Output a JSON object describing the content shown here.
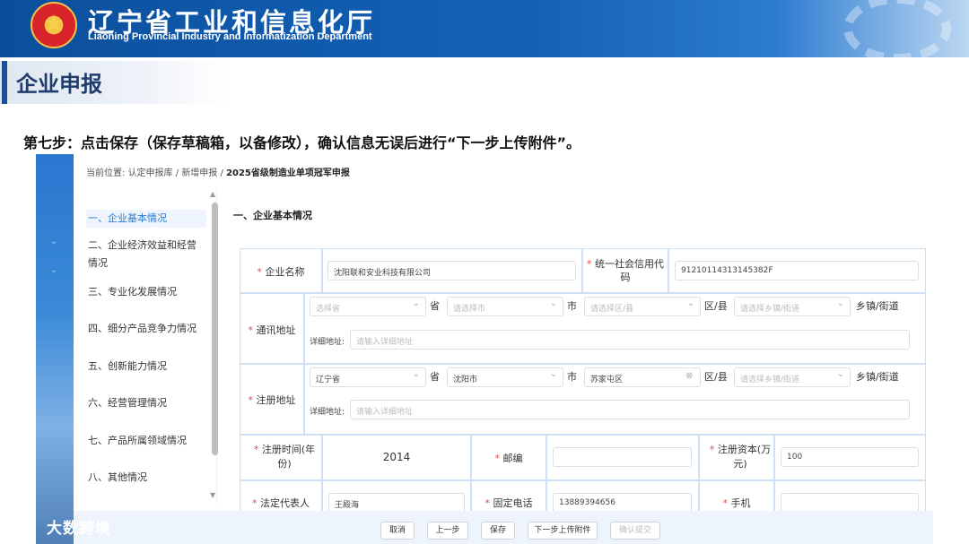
{
  "banner": {
    "title": "辽宁省工业和信息化厅",
    "subtitle": "Liaoning Provincial Industry and Informatization Department"
  },
  "section_title": "企业申报",
  "step_instruction": "第七步：点击保存（保存草稿箱，以备修改），确认信息无误后进行“下一步上传附件”。",
  "breadcrumb": {
    "prefix": "当前位置:",
    "items": [
      "认定申报库",
      "/",
      "新增申报",
      "/"
    ],
    "current": "2025省级制造业单项冠军申报"
  },
  "sidebar": {
    "items": [
      {
        "label": "一、企业基本情况",
        "active": true
      },
      {
        "label": "二、企业经济效益和经营情况"
      },
      {
        "label": "三、专业化发展情况"
      },
      {
        "label": "四、细分产品竞争力情况"
      },
      {
        "label": "五、创新能力情况"
      },
      {
        "label": "六、经营管理情况"
      },
      {
        "label": "七、产品所属领域情况"
      },
      {
        "label": "八、其他情况"
      }
    ]
  },
  "form": {
    "section_title": "一、企业基本情况",
    "company_name": {
      "label": "企业名称",
      "value": "沈阳联和安业科技有限公司"
    },
    "credit_code": {
      "label": "统一社会信用代码",
      "value": "91210114313145382F"
    },
    "mail_address": {
      "label": "通讯地址",
      "province": {
        "placeholder": "选择省"
      },
      "city": {
        "placeholder": "请选择市"
      },
      "district": {
        "placeholder": "请选择区/县"
      },
      "town": {
        "placeholder": "请选择乡镇/街道"
      },
      "detail_label": "详细地址:",
      "detail_placeholder": "请输入详细地址"
    },
    "reg_address": {
      "label": "注册地址",
      "province": {
        "value": "辽宁省"
      },
      "city": {
        "value": "沈阳市"
      },
      "district": {
        "value": "苏家屯区"
      },
      "town": {
        "placeholder": "请选择乡镇/街道"
      },
      "detail_label": "详细地址:",
      "detail_placeholder": "请输入详细地址"
    },
    "units": {
      "province": "省",
      "city": "市",
      "district": "区/县",
      "town": "乡镇/街道"
    },
    "reg_year": {
      "label": "注册时间(年份)",
      "value": "2014"
    },
    "postcode": {
      "label": "邮编",
      "value": ""
    },
    "reg_capital": {
      "label": "注册资本(万元)",
      "value": "100"
    },
    "legal_rep": {
      "label": "法定代表人",
      "value": "王殿海"
    },
    "landline": {
      "label": "固定电话",
      "value": "13889394656"
    },
    "mobile": {
      "label": "手机",
      "value": ""
    }
  },
  "toolbar": {
    "buttons": [
      {
        "label": "取消"
      },
      {
        "label": "上一步"
      },
      {
        "label": "保存"
      },
      {
        "label": "下一步上传附件"
      },
      {
        "label": "确认提交",
        "disabled": true
      }
    ]
  },
  "watermark": {
    "logo": "ⓒ∞",
    "text": "大数跨境"
  },
  "colors": {
    "banner": "#1462b8",
    "accent": "#2a7ad4",
    "required": "#e24b4b",
    "section_text": "#1f3c6d"
  }
}
